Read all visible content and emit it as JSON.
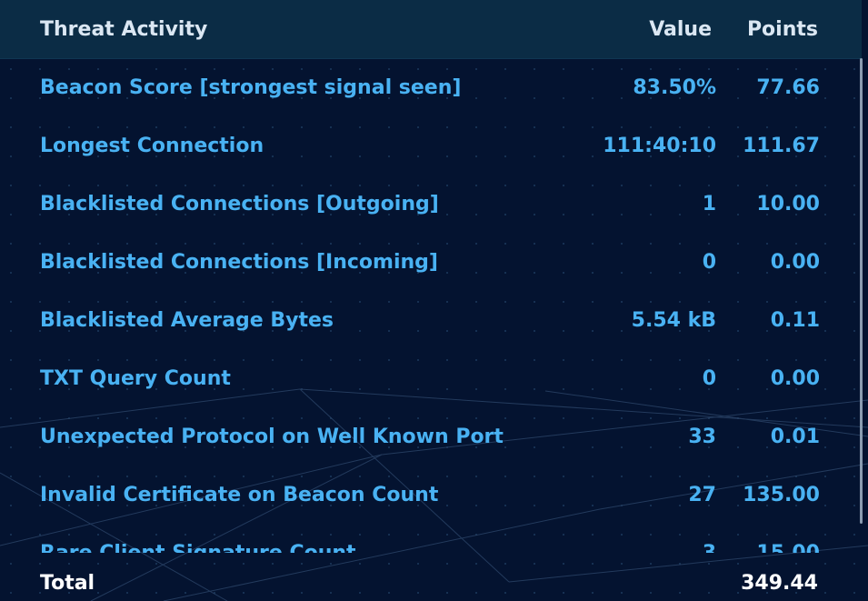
{
  "header": {
    "activity": "Threat Activity",
    "value": "Value",
    "points": "Points"
  },
  "rows": [
    {
      "name": "Beacon Score [strongest signal seen]",
      "value": "83.50%",
      "points": "77.66"
    },
    {
      "name": "Longest Connection",
      "value": "111:40:10",
      "points": "111.67"
    },
    {
      "name": "Blacklisted Connections [Outgoing]",
      "value": "1",
      "points": "10.00"
    },
    {
      "name": "Blacklisted Connections [Incoming]",
      "value": "0",
      "points": "0.00"
    },
    {
      "name": "Blacklisted Average Bytes",
      "value": "5.54 kB",
      "points": "0.11"
    },
    {
      "name": "TXT Query Count",
      "value": "0",
      "points": "0.00"
    },
    {
      "name": "Unexpected Protocol on Well Known Port",
      "value": "33",
      "points": "0.01"
    },
    {
      "name": "Invalid Certificate on Beacon Count",
      "value": "27",
      "points": "135.00"
    },
    {
      "name": "Rare Client Signature Count",
      "value": "3",
      "points": "15.00"
    }
  ],
  "footer": {
    "total_label": "Total",
    "total_value": "349.44"
  },
  "colors": {
    "background": "#041330",
    "header_background": "#0b2c45",
    "row_text": "#49b2f3",
    "header_text": "#dbe7f3",
    "total_text": "#ffffff"
  }
}
